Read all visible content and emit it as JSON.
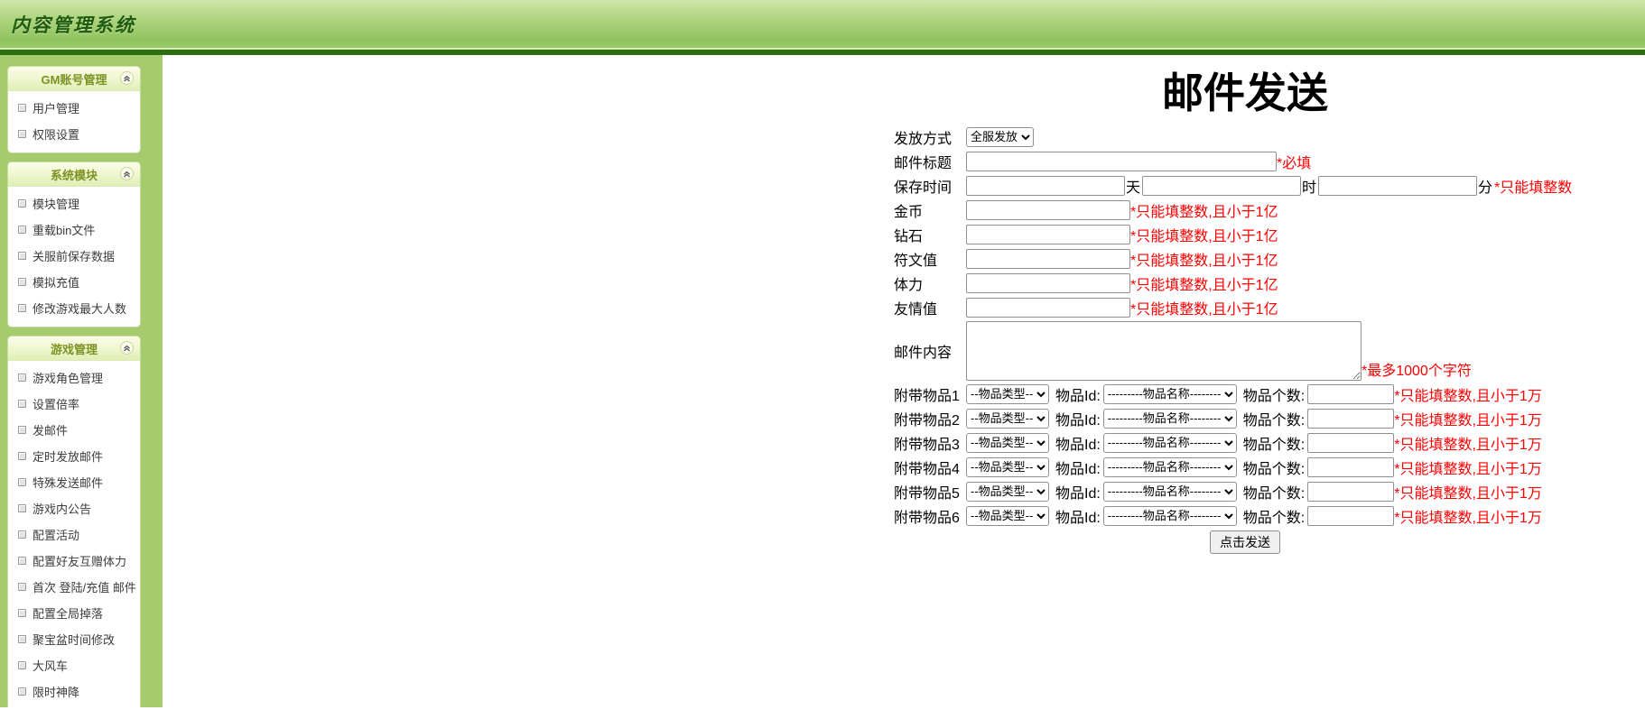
{
  "page": {
    "title": "内容管理系统"
  },
  "colors": {
    "header_green_light": "#cfe8a9",
    "header_green_dark": "#8fc35e",
    "divider_dark_green": "#2c6e11",
    "sidebar_green": "#a6cb6c",
    "panel_title_olive": "#7c9222",
    "note_red": "#ff0000"
  },
  "icons": {
    "panel_collapse": "double-chevron-up",
    "item_bullet": "small-square"
  },
  "sidebar": {
    "panels": [
      {
        "title": "GM账号管理",
        "items": [
          "用户管理",
          "权限设置"
        ]
      },
      {
        "title": "系统模块",
        "items": [
          "模块管理",
          "重载bin文件",
          "关服前保存数据",
          "模拟充值",
          "修改游戏最大人数"
        ]
      },
      {
        "title": "游戏管理",
        "items": [
          "游戏角色管理",
          "设置倍率",
          "发邮件",
          "定时发放邮件",
          "特殊发送邮件",
          "游戏内公告",
          "配置活动",
          "配置好友互赠体力",
          "首次 登陆/充值 邮件",
          "配置全局掉落",
          "聚宝盆时间修改",
          "大风车",
          "限时神降"
        ]
      }
    ]
  },
  "form": {
    "title": "邮件发送",
    "send_mode_label": "发放方式",
    "send_mode_value": "全服发放",
    "mail_title_label": "邮件标题",
    "mail_title_value": "",
    "mail_title_note": "*必填",
    "save_time_label": "保存时间",
    "save_time_value_day": "",
    "save_time_value_hour": "",
    "save_time_value_minute": "",
    "save_time_units": {
      "day": "天",
      "hour": "时",
      "minute": "分"
    },
    "save_time_note": "*只能填整数",
    "currency_rows": [
      {
        "label": "金币",
        "value": "",
        "note": "*只能填整数,且小于1亿"
      },
      {
        "label": "钻石",
        "value": "",
        "note": "*只能填整数,且小于1亿"
      },
      {
        "label": "符文值",
        "value": "",
        "note": "*只能填整数,且小于1亿"
      },
      {
        "label": "体力",
        "value": "",
        "note": "*只能填整数,且小于1亿"
      },
      {
        "label": "友情值",
        "value": "",
        "note": "*只能填整数,且小于1亿"
      }
    ],
    "content_label": "邮件内容",
    "content_value": "",
    "content_note": "*最多1000个字符",
    "item_rows": [
      {
        "label": "附带物品1",
        "type_value": "--物品类型--",
        "id_label": "物品Id:",
        "name_value": "---------物品名称--------",
        "count_label": "物品个数:",
        "count_value": "",
        "note": "*只能填整数,且小于1万"
      },
      {
        "label": "附带物品2",
        "type_value": "--物品类型--",
        "id_label": "物品Id:",
        "name_value": "---------物品名称--------",
        "count_label": "物品个数:",
        "count_value": "",
        "note": "*只能填整数,且小于1万"
      },
      {
        "label": "附带物品3",
        "type_value": "--物品类型--",
        "id_label": "物品Id:",
        "name_value": "---------物品名称--------",
        "count_label": "物品个数:",
        "count_value": "",
        "note": "*只能填整数,且小于1万"
      },
      {
        "label": "附带物品4",
        "type_value": "--物品类型--",
        "id_label": "物品Id:",
        "name_value": "---------物品名称--------",
        "count_label": "物品个数:",
        "count_value": "",
        "note": "*只能填整数,且小于1万"
      },
      {
        "label": "附带物品5",
        "type_value": "--物品类型--",
        "id_label": "物品Id:",
        "name_value": "---------物品名称--------",
        "count_label": "物品个数:",
        "count_value": "",
        "note": "*只能填整数,且小于1万"
      },
      {
        "label": "附带物品6",
        "type_value": "--物品类型--",
        "id_label": "物品Id:",
        "name_value": "---------物品名称--------",
        "count_label": "物品个数:",
        "count_value": "",
        "note": "*只能填整数,且小于1万"
      }
    ],
    "submit_label": "点击发送"
  }
}
